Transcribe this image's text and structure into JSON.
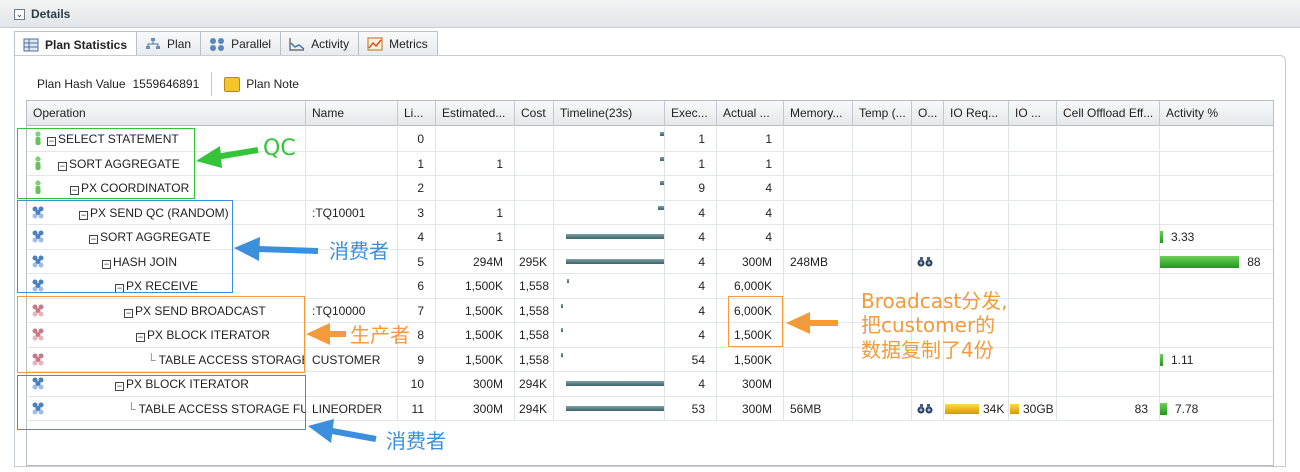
{
  "section": {
    "title": "Details"
  },
  "tabs": [
    {
      "label": "Plan Statistics",
      "icon": "table-icon"
    },
    {
      "label": "Plan",
      "icon": "tree-icon"
    },
    {
      "label": "Parallel",
      "icon": "parallel-servers-icon"
    },
    {
      "label": "Activity",
      "icon": "line-chart-icon"
    },
    {
      "label": "Metrics",
      "icon": "metrics-chart-icon"
    }
  ],
  "plan_info": {
    "hash_label": "Plan Hash Value",
    "hash_value": "1559646891",
    "note_label": "Plan Note"
  },
  "columns": [
    "Operation",
    "Name",
    "Li...",
    "Estimated...",
    "Cost",
    "Timeline(23s)",
    "Exec...",
    "Actual ...",
    "Memory...",
    "Temp (...",
    "O...",
    "IO Req...",
    "IO ...",
    "Cell Offload Eff...",
    "Activity %"
  ],
  "rows": [
    {
      "op": "SELECT STATEMENT",
      "name": "",
      "line": "0",
      "est": "",
      "cost": "",
      "exec": "1",
      "actual": "1",
      "memory": "",
      "io_req": "",
      "io_bytes": "",
      "offload": "",
      "activity": "",
      "icon": "qc-icon"
    },
    {
      "op": "SORT AGGREGATE",
      "name": "",
      "line": "1",
      "est": "1",
      "cost": "",
      "exec": "1",
      "actual": "1",
      "memory": "",
      "io_req": "",
      "io_bytes": "",
      "offload": "",
      "activity": "",
      "icon": "qc-icon"
    },
    {
      "op": "PX COORDINATOR",
      "name": "",
      "line": "2",
      "est": "",
      "cost": "",
      "exec": "9",
      "actual": "4",
      "memory": "",
      "io_req": "",
      "io_bytes": "",
      "offload": "",
      "activity": "",
      "icon": "qc-icon"
    },
    {
      "op": "PX SEND QC (RANDOM)",
      "name": ":TQ10001",
      "line": "3",
      "est": "1",
      "cost": "",
      "exec": "4",
      "actual": "4",
      "memory": "",
      "io_req": "",
      "io_bytes": "",
      "offload": "",
      "activity": "",
      "icon": "consumer-icon"
    },
    {
      "op": "SORT AGGREGATE",
      "name": "",
      "line": "4",
      "est": "1",
      "cost": "",
      "exec": "4",
      "actual": "4",
      "memory": "",
      "io_req": "",
      "io_bytes": "",
      "offload": "",
      "activity": "3.33",
      "icon": "consumer-icon"
    },
    {
      "op": "HASH JOIN",
      "name": "",
      "line": "5",
      "est": "294M",
      "cost": "295K",
      "exec": "4",
      "actual": "300M",
      "memory": "248MB",
      "io_req": "",
      "io_bytes": "",
      "offload": "",
      "activity": "88",
      "icon": "consumer-icon"
    },
    {
      "op": "PX RECEIVE",
      "name": "",
      "line": "6",
      "est": "1,500K",
      "cost": "1,558",
      "exec": "4",
      "actual": "6,000K",
      "memory": "",
      "io_req": "",
      "io_bytes": "",
      "offload": "",
      "activity": "",
      "icon": "consumer-icon"
    },
    {
      "op": "PX SEND BROADCAST",
      "name": ":TQ10000",
      "line": "7",
      "est": "1,500K",
      "cost": "1,558",
      "exec": "4",
      "actual": "6,000K",
      "memory": "",
      "io_req": "",
      "io_bytes": "",
      "offload": "",
      "activity": "",
      "icon": "producer-icon"
    },
    {
      "op": "PX BLOCK ITERATOR",
      "name": "",
      "line": "8",
      "est": "1,500K",
      "cost": "1,558",
      "exec": "4",
      "actual": "1,500K",
      "memory": "",
      "io_req": "",
      "io_bytes": "",
      "offload": "",
      "activity": "",
      "icon": "producer-icon"
    },
    {
      "op": "TABLE ACCESS STORAGE...",
      "name": "CUSTOMER",
      "line": "9",
      "est": "1,500K",
      "cost": "1,558",
      "exec": "54",
      "actual": "1,500K",
      "memory": "",
      "io_req": "",
      "io_bytes": "",
      "offload": "",
      "activity": "1.11",
      "icon": "producer-icon"
    },
    {
      "op": "PX BLOCK ITERATOR",
      "name": "",
      "line": "10",
      "est": "300M",
      "cost": "294K",
      "exec": "4",
      "actual": "300M",
      "memory": "",
      "io_req": "",
      "io_bytes": "",
      "offload": "",
      "activity": "",
      "icon": "consumer-icon"
    },
    {
      "op": "TABLE ACCESS STORAGE FULL",
      "name": "LINEORDER",
      "line": "11",
      "est": "300M",
      "cost": "294K",
      "exec": "53",
      "actual": "300M",
      "memory": "56MB",
      "io_req": "34K",
      "io_bytes": "30GB",
      "offload": "83",
      "activity": "7.78",
      "icon": "consumer-icon"
    }
  ],
  "annotations": {
    "qc": "QC",
    "consumer1": "消费者",
    "producer": "生产者",
    "broadcast_line1": "Broadcast分发,",
    "broadcast_line2": "把customer的",
    "broadcast_line3": "数据复制了4份",
    "consumer2": "消费者"
  },
  "colors": {
    "qc_green": "#33c43a",
    "consumer_blue": "#3b8fdc",
    "producer_orange": "#f39a3a",
    "activity_green": "#2ea826",
    "timeline": "#4d7479"
  }
}
